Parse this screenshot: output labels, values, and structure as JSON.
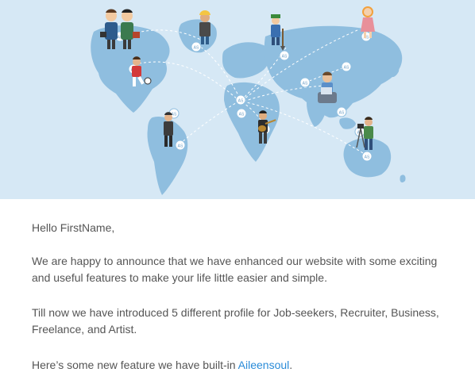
{
  "hero": {
    "colors": {
      "background": "#d6e8f5",
      "land": "#8fbedf",
      "pin": "#ffffff"
    },
    "badge_label": "AS",
    "icon": "world-map-with-professionals"
  },
  "email": {
    "greeting": "Hello FirstName,",
    "para1": "We are happy to announce that we have enhanced our website with some exciting and useful features to make your life little easier and simple.",
    "para2": "Till now we have introduced 5 different profile for Job-seekers, Recruiter, Business, Freelance, and Artist.",
    "para3_prefix": "Here’s some new feature we have built-in ",
    "link_text": "Aileensoul",
    "para3_suffix": ".",
    "colors": {
      "text": "#555555",
      "link": "#2a8bd8"
    }
  }
}
